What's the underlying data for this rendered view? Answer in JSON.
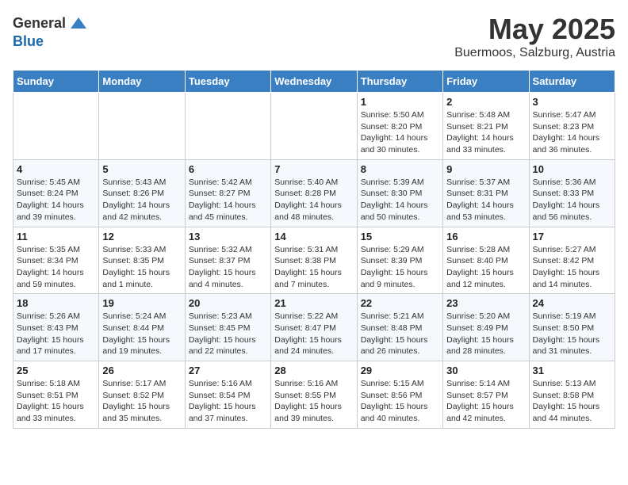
{
  "logo": {
    "general": "General",
    "blue": "Blue"
  },
  "header": {
    "month": "May 2025",
    "location": "Buermoos, Salzburg, Austria"
  },
  "weekdays": [
    "Sunday",
    "Monday",
    "Tuesday",
    "Wednesday",
    "Thursday",
    "Friday",
    "Saturday"
  ],
  "weeks": [
    [
      {
        "day": "",
        "info": ""
      },
      {
        "day": "",
        "info": ""
      },
      {
        "day": "",
        "info": ""
      },
      {
        "day": "",
        "info": ""
      },
      {
        "day": "1",
        "info": "Sunrise: 5:50 AM\nSunset: 8:20 PM\nDaylight: 14 hours\nand 30 minutes."
      },
      {
        "day": "2",
        "info": "Sunrise: 5:48 AM\nSunset: 8:21 PM\nDaylight: 14 hours\nand 33 minutes."
      },
      {
        "day": "3",
        "info": "Sunrise: 5:47 AM\nSunset: 8:23 PM\nDaylight: 14 hours\nand 36 minutes."
      }
    ],
    [
      {
        "day": "4",
        "info": "Sunrise: 5:45 AM\nSunset: 8:24 PM\nDaylight: 14 hours\nand 39 minutes."
      },
      {
        "day": "5",
        "info": "Sunrise: 5:43 AM\nSunset: 8:26 PM\nDaylight: 14 hours\nand 42 minutes."
      },
      {
        "day": "6",
        "info": "Sunrise: 5:42 AM\nSunset: 8:27 PM\nDaylight: 14 hours\nand 45 minutes."
      },
      {
        "day": "7",
        "info": "Sunrise: 5:40 AM\nSunset: 8:28 PM\nDaylight: 14 hours\nand 48 minutes."
      },
      {
        "day": "8",
        "info": "Sunrise: 5:39 AM\nSunset: 8:30 PM\nDaylight: 14 hours\nand 50 minutes."
      },
      {
        "day": "9",
        "info": "Sunrise: 5:37 AM\nSunset: 8:31 PM\nDaylight: 14 hours\nand 53 minutes."
      },
      {
        "day": "10",
        "info": "Sunrise: 5:36 AM\nSunset: 8:33 PM\nDaylight: 14 hours\nand 56 minutes."
      }
    ],
    [
      {
        "day": "11",
        "info": "Sunrise: 5:35 AM\nSunset: 8:34 PM\nDaylight: 14 hours\nand 59 minutes."
      },
      {
        "day": "12",
        "info": "Sunrise: 5:33 AM\nSunset: 8:35 PM\nDaylight: 15 hours\nand 1 minute."
      },
      {
        "day": "13",
        "info": "Sunrise: 5:32 AM\nSunset: 8:37 PM\nDaylight: 15 hours\nand 4 minutes."
      },
      {
        "day": "14",
        "info": "Sunrise: 5:31 AM\nSunset: 8:38 PM\nDaylight: 15 hours\nand 7 minutes."
      },
      {
        "day": "15",
        "info": "Sunrise: 5:29 AM\nSunset: 8:39 PM\nDaylight: 15 hours\nand 9 minutes."
      },
      {
        "day": "16",
        "info": "Sunrise: 5:28 AM\nSunset: 8:40 PM\nDaylight: 15 hours\nand 12 minutes."
      },
      {
        "day": "17",
        "info": "Sunrise: 5:27 AM\nSunset: 8:42 PM\nDaylight: 15 hours\nand 14 minutes."
      }
    ],
    [
      {
        "day": "18",
        "info": "Sunrise: 5:26 AM\nSunset: 8:43 PM\nDaylight: 15 hours\nand 17 minutes."
      },
      {
        "day": "19",
        "info": "Sunrise: 5:24 AM\nSunset: 8:44 PM\nDaylight: 15 hours\nand 19 minutes."
      },
      {
        "day": "20",
        "info": "Sunrise: 5:23 AM\nSunset: 8:45 PM\nDaylight: 15 hours\nand 22 minutes."
      },
      {
        "day": "21",
        "info": "Sunrise: 5:22 AM\nSunset: 8:47 PM\nDaylight: 15 hours\nand 24 minutes."
      },
      {
        "day": "22",
        "info": "Sunrise: 5:21 AM\nSunset: 8:48 PM\nDaylight: 15 hours\nand 26 minutes."
      },
      {
        "day": "23",
        "info": "Sunrise: 5:20 AM\nSunset: 8:49 PM\nDaylight: 15 hours\nand 28 minutes."
      },
      {
        "day": "24",
        "info": "Sunrise: 5:19 AM\nSunset: 8:50 PM\nDaylight: 15 hours\nand 31 minutes."
      }
    ],
    [
      {
        "day": "25",
        "info": "Sunrise: 5:18 AM\nSunset: 8:51 PM\nDaylight: 15 hours\nand 33 minutes."
      },
      {
        "day": "26",
        "info": "Sunrise: 5:17 AM\nSunset: 8:52 PM\nDaylight: 15 hours\nand 35 minutes."
      },
      {
        "day": "27",
        "info": "Sunrise: 5:16 AM\nSunset: 8:54 PM\nDaylight: 15 hours\nand 37 minutes."
      },
      {
        "day": "28",
        "info": "Sunrise: 5:16 AM\nSunset: 8:55 PM\nDaylight: 15 hours\nand 39 minutes."
      },
      {
        "day": "29",
        "info": "Sunrise: 5:15 AM\nSunset: 8:56 PM\nDaylight: 15 hours\nand 40 minutes."
      },
      {
        "day": "30",
        "info": "Sunrise: 5:14 AM\nSunset: 8:57 PM\nDaylight: 15 hours\nand 42 minutes."
      },
      {
        "day": "31",
        "info": "Sunrise: 5:13 AM\nSunset: 8:58 PM\nDaylight: 15 hours\nand 44 minutes."
      }
    ]
  ]
}
